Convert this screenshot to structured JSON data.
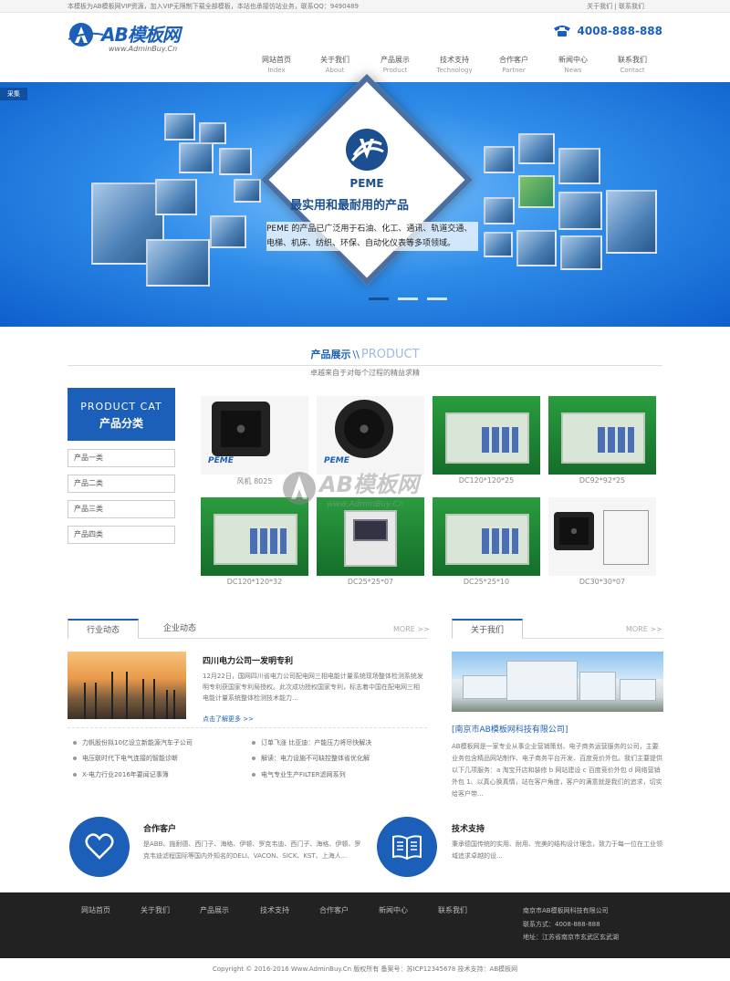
{
  "topbar": {
    "notice": "本模板为AB模板网VIP资源，加入VIP无限制下载全部模板，本站也承接仿站业务，联系QQ：9490489",
    "link1": "关于我们",
    "sep": "|",
    "link2": "联系我们"
  },
  "logo": {
    "brand": "AB模板网",
    "url": "www.AdminBuy.Cn"
  },
  "phone": {
    "number": "4008-888-888",
    "icon": "phone-icon"
  },
  "nav": [
    {
      "cn": "网站首页",
      "en": "Index"
    },
    {
      "cn": "关于我们",
      "en": "About"
    },
    {
      "cn": "产品展示",
      "en": "Product"
    },
    {
      "cn": "技术支持",
      "en": "Technology"
    },
    {
      "cn": "合作客户",
      "en": "Partner"
    },
    {
      "cn": "新闻中心",
      "en": "News"
    },
    {
      "cn": "联系我们",
      "en": "Contact"
    }
  ],
  "banner": {
    "tag": "采集",
    "brand": "PEME",
    "title": "最实用和最耐用的产品",
    "desc": "PEME 的产品已广泛用于石油、化工、通讯、轨道交通、电梯、机床、纺织、环保、自动化仪表等多项领域。",
    "slide_count": 3,
    "active_slide": 1
  },
  "products_section": {
    "title_cn": "产品展示",
    "title_sep": "\\\\",
    "title_en": "PRODUCT",
    "subtitle": "卓越来自于对每个过程的精益求精"
  },
  "categories": {
    "title_en": "PRODUCT CAT",
    "title_cn": "产品分类",
    "items": [
      "产品一类",
      "产品二类",
      "产品三类",
      "产品四类"
    ]
  },
  "products": [
    "风机 8025",
    "",
    "DC120*120*25",
    "DC92*92*25",
    "DC120*120*32",
    "DC25*25*07",
    "DC25*25*10",
    "DC30*30*07"
  ],
  "product_badges": {
    "peme": "PEME"
  },
  "news": {
    "tab1": "行业动态",
    "tab2": "企业动态",
    "more": "MORE >>",
    "headline": "四川电力公司一发明专利",
    "body": "12月22日，国网四川省电力公司配电网三相电能计量系统现场整体检测系统发明专利获国家专利局授权。此次成功授权国家专利，标志着中国在配电网三相电能计量系统整体检测技术能力...",
    "read_more": "点击了解更多 >>",
    "list": [
      "力帆股份拟10亿设立新能源汽车子公司",
      "订单飞涨 比亚迪：产能压力将尽快解决",
      "电压联时代下电气连接的智能诊断",
      "解读：电力设施不可缺控整体省优化解",
      "X-电力行业2016年要闻记事簿",
      "电气专业生产FILTER滤网系列"
    ]
  },
  "about": {
    "tab": "关于我们",
    "more": "MORE >>",
    "name": "[南京市AB模板网科技有限公司]",
    "body": "AB模板网是一家专业从事企业营销策划、电子商务运营服务的公司，主要业务包含精品网站制作、电子商务平台开发、百度竞价外包。我们主要提供以下几项服务：a 淘宝开店和装修 b 网站建设 c 百度竞价外包 d 网络营销外包 1、以真心换真情，站在客户角度，客户的满意就是我们的追求，切实给客户带..."
  },
  "features": [
    {
      "title": "合作客户",
      "body": "是ABB、施耐德、西门子、海格、伊顿、罗克韦迪、西门子、海格、伊顿、罗克韦迪滤程国际等国内外知名的DELI、VACON、SICK、KST、上海人...",
      "icon": "heart-icon"
    },
    {
      "title": "技术支持",
      "body": "秉承德国传统的实用、耐用、完美的结构设计理念，致力于每一位在工业领域追求卓越的设...",
      "icon": "book-icon"
    }
  ],
  "footer": {
    "links": [
      "网站首页",
      "关于我们",
      "产品展示",
      "技术支持",
      "合作客户",
      "新闻中心",
      "联系我们"
    ],
    "company": "南京市AB模板网科技有限公司",
    "phone": "联系方式：4008-888-888",
    "address": "地址：江苏省南京市玄武区玄武湖",
    "copyright": "Copyright © 2016-2016 Www.AdminBuy.Cn 版权所有  备案号：苏ICP12345678  技术支持：AB模板网"
  },
  "watermark": {
    "brand": "AB模板网",
    "url": "www.AdminBuy.Cn"
  },
  "colors": {
    "brand": "#1b5fb8",
    "footer_bg": "#222222",
    "banner_center": "#7fc4ff",
    "banner_edge": "#0e5fcc"
  }
}
